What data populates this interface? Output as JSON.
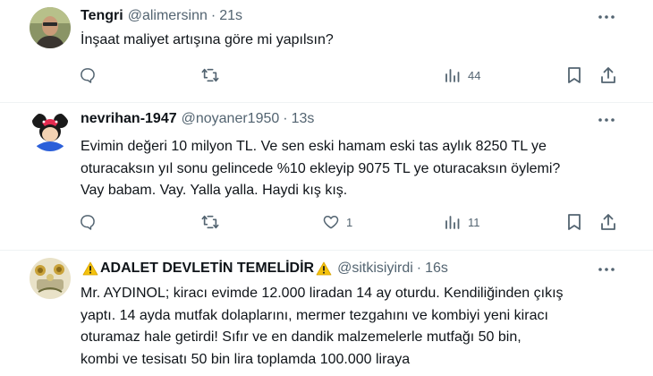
{
  "tweets": [
    {
      "name": "Tengri",
      "handle": "@alimersinn",
      "dot": "·",
      "time": "21s",
      "text": "İnşaat maliyet artışına göre mi  yapılsın?",
      "replies": "",
      "retweets": "",
      "likes": "",
      "views": "44"
    },
    {
      "name": "nevrihan-1947",
      "handle": "@noyaner1950",
      "dot": "·",
      "time": "13s",
      "text": "Evimin değeri 10 milyon TL. Ve sen eski hamam eski tas aylık  8250 TL ye\noturacaksın yıl sonu gelincede %10 ekleyip  9075 TL ye oturacaksın öylemi?\nVay babam. Vay. Yalla yalla. Haydi kış kış.",
      "replies": "",
      "retweets": "",
      "likes": "1",
      "views": "11"
    },
    {
      "name": "ADALET DEVLETİN TEMELİDİR",
      "handle": "@sitkisiyirdi",
      "dot": "·",
      "time": "16s",
      "text": "Mr. AYDINOL; kiracı evimde 12.000 liradan 14 ay oturdu. Kendiliğinden çıkış\nyaptı. 14 ayda mutfak dolaplarını, mermer tezgahını ve kombiyi yeni kiracı\noturamaz hale getirdi! Sıfır ve en dandik malzemelerle mutfağı 50 bin,\nkombi ve tesisatı 50 bin lira toplamda 100.000 liraya"
    }
  ],
  "colors": {
    "text": "#0f1419",
    "secondary": "#536471",
    "divider": "#eff3f4",
    "warning": "#f4c20d"
  },
  "icons": [
    "reply-icon",
    "retweet-icon",
    "like-icon",
    "views-icon",
    "bookmark-icon",
    "share-icon",
    "more-icon",
    "warning-icon"
  ]
}
